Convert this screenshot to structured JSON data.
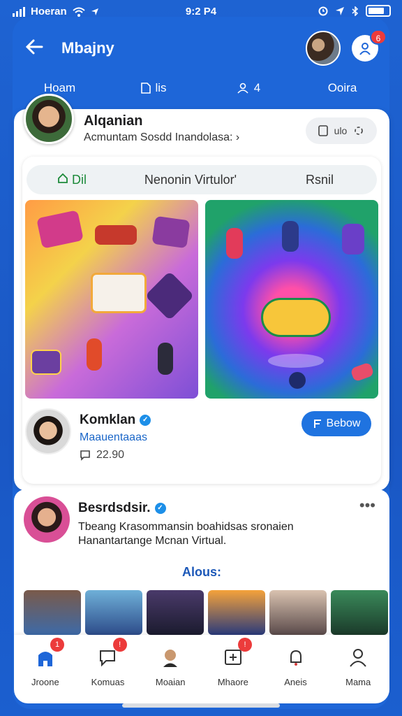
{
  "status_bar": {
    "carrier": "Hoeran",
    "time": "9:2 P4"
  },
  "header": {
    "title": "Mbajny",
    "notification_count": "6",
    "tabs": [
      {
        "label": "Hoam"
      },
      {
        "label": "lis"
      },
      {
        "label": "4"
      },
      {
        "label": "Ooira"
      }
    ]
  },
  "profile": {
    "name": "Alqanian",
    "subtitle": "Acmuntam Sosdd Inandolasa:",
    "actions_label": "ulo"
  },
  "filters": [
    "Dil",
    "Nenonin Virtulor'",
    "Rsnil"
  ],
  "influencer": {
    "name": "Komklan",
    "subtitle": "Maauentaaas",
    "count": "22.90",
    "follow_label": "Bebow"
  },
  "post": {
    "author": "Besrdsdsir.",
    "text_line1": "Tbeang Krasommansin boahidsas sronaien",
    "text_line2": "Hanantartange Mcnan Virtual.",
    "section_title": "Alous:"
  },
  "bottom_nav": [
    {
      "label": "Jroone",
      "badge": "1"
    },
    {
      "label": "Komuas",
      "badge": "!"
    },
    {
      "label": "Moaian",
      "badge": ""
    },
    {
      "label": "Mhaore",
      "badge": "!"
    },
    {
      "label": "Aneis",
      "badge": ""
    },
    {
      "label": "Mama",
      "badge": ""
    }
  ],
  "colors": {
    "brand_blue": "#1e66d8",
    "badge_red": "#ec3b3b",
    "verify_blue": "#1d8fe8",
    "follow_blue": "#1f73e0"
  },
  "icons": [
    "back-arrow-icon",
    "wifi-icon",
    "signal-icon",
    "battery-icon",
    "bluetooth-icon",
    "location-icon",
    "verified-icon",
    "comment-icon",
    "more-icon"
  ]
}
